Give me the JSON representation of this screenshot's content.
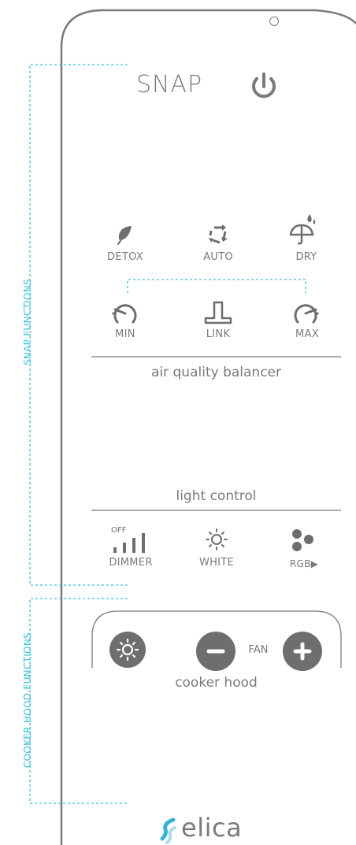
{
  "brand": "SNAP",
  "sections": {
    "snap_functions": "SNAP FUNCTIONS",
    "cooker_hood_functions": "COOKER HOOD FUNCTIONS"
  },
  "modes": {
    "detox": "DETOX",
    "auto": "AUTO",
    "dry": "DRY"
  },
  "air": {
    "min": "MIN",
    "link": "LINK",
    "max": "MAX",
    "title": "air quality balancer"
  },
  "light": {
    "title": "light control",
    "off": "OFF",
    "dimmer": "DIMMER",
    "white": "WHITE",
    "rgb": "RGB▶"
  },
  "hood": {
    "fan": "FAN",
    "title": "cooker hood"
  },
  "logo": "elica",
  "colors": {
    "accent": "#3cc0d8",
    "text": "#7a7a7a",
    "button": "#6e6e6e"
  }
}
